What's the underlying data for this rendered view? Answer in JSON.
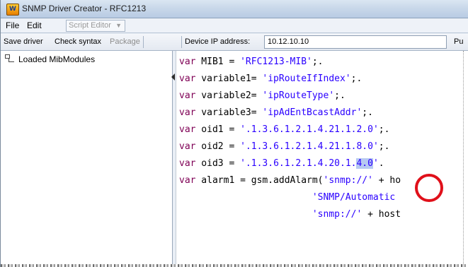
{
  "window": {
    "title": "SNMP Driver Creator - RFC1213",
    "app_icon_label": "W"
  },
  "menubar": {
    "file": "File",
    "edit": "Edit",
    "script_editor": "Script Editor"
  },
  "toolbar": {
    "save_driver": "Save driver",
    "check_syntax": "Check syntax",
    "package": "Package",
    "device_ip_label": "Device IP address:",
    "device_ip_value": "10.12.10.10",
    "trailing_cut": "Pu"
  },
  "left_panel": {
    "tree_root": "Loaded MibModules"
  },
  "editor": {
    "lines": [
      {
        "kw": "var",
        "pre": " MIB1 = ",
        "str": "'RFC1213-MIB'",
        "post": ";."
      },
      {
        "kw": "var",
        "pre": " variable1= ",
        "str": "'ipRouteIfIndex'",
        "post": ";."
      },
      {
        "kw": "var",
        "pre": " variable2= ",
        "str": "'ipRouteType'",
        "post": ";."
      },
      {
        "kw": "var",
        "pre": " variable3= ",
        "str": "'ipAdEntBcastAddr'",
        "post": ";."
      },
      {
        "kw": "var",
        "pre": " oid1 = ",
        "str": "'.1.3.6.1.2.1.4.21.1.2.0'",
        "post": ";."
      },
      {
        "kw": "var",
        "pre": " oid2 = ",
        "str": "'.1.3.6.1.2.1.4.21.1.8.0'",
        "post": ";."
      },
      {
        "kw": "var",
        "pre": " oid3 = ",
        "str_a": "'.1.3.6.1.2.1.4.20.1.",
        "str_sel": "4.0",
        "str_b": "'",
        "post": "."
      },
      {
        "kw": "var",
        "pre": " alarm1 = gsm.addAlarm(",
        "str": "'snmp://'",
        "post": " + ho"
      },
      {
        "indent": "                        ",
        "str": "'SNMP/Automatic"
      },
      {
        "indent": "                        ",
        "str": "'snmp://'",
        "post": " + host"
      }
    ]
  }
}
